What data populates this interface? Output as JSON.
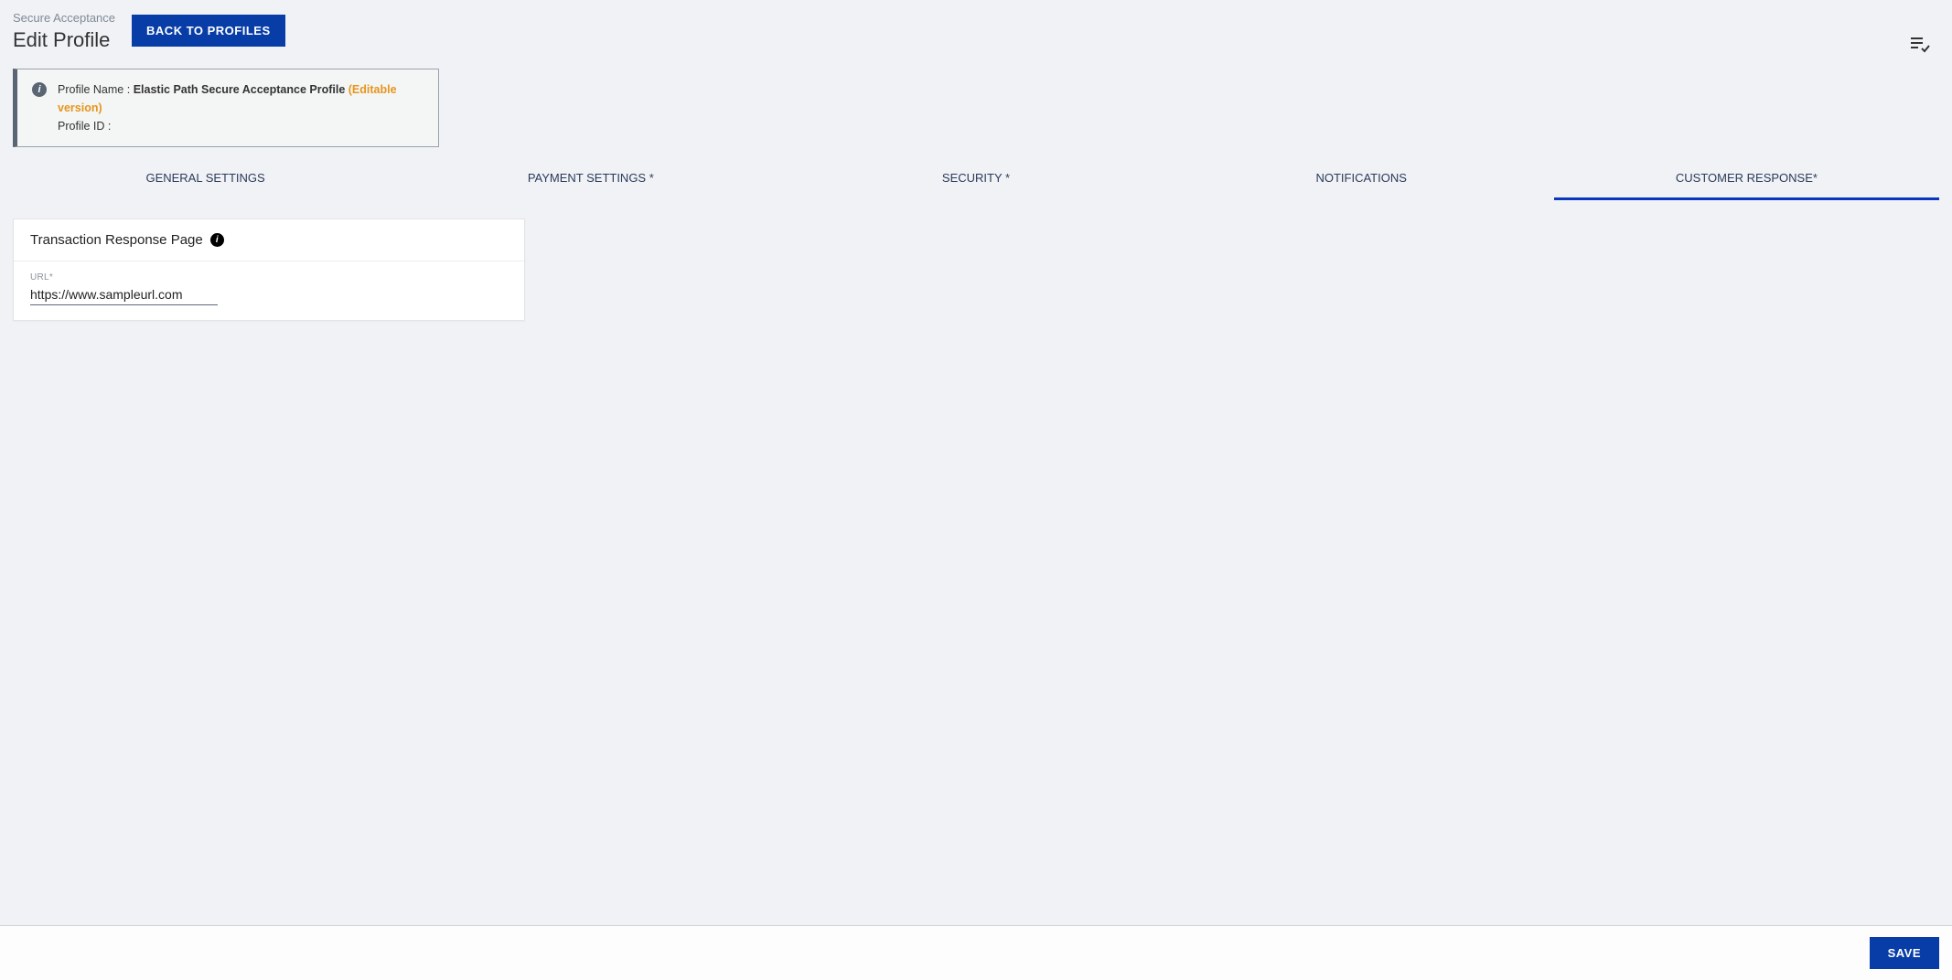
{
  "header": {
    "breadcrumb": "Secure Acceptance",
    "title": "Edit Profile",
    "back_button": "BACK TO PROFILES"
  },
  "info_panel": {
    "profile_name_label": "Profile Name :",
    "profile_name_value": "Elastic Path Secure Acceptance Profile",
    "editable_label": "(Editable version)",
    "profile_id_label": "Profile ID :",
    "profile_id_value": ""
  },
  "tabs": [
    {
      "label": "GENERAL SETTINGS",
      "active": false
    },
    {
      "label": "PAYMENT SETTINGS *",
      "active": false
    },
    {
      "label": "SECURITY *",
      "active": false
    },
    {
      "label": "NOTIFICATIONS",
      "active": false
    },
    {
      "label": "CUSTOMER RESPONSE*",
      "active": true
    }
  ],
  "card": {
    "title": "Transaction Response Page",
    "url_label": "URL*",
    "url_value": "https://www.sampleurl.com"
  },
  "footer": {
    "save_label": "SAVE"
  }
}
